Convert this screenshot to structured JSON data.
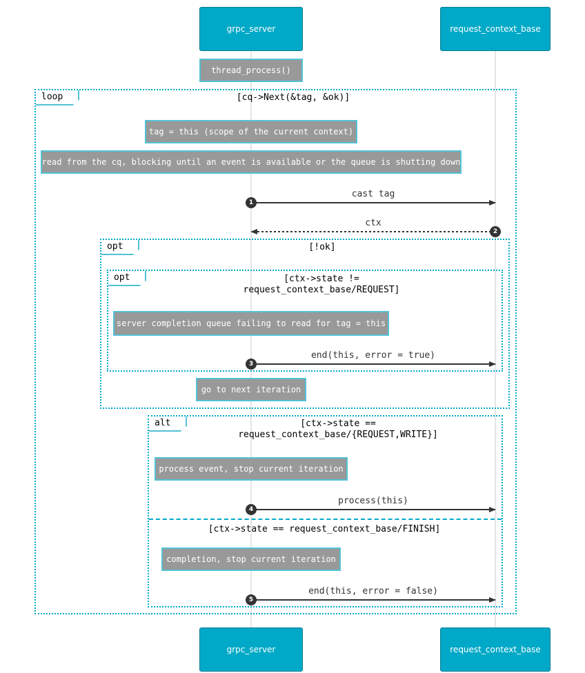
{
  "participants": {
    "grpc_server": "grpc_server",
    "request_context_base": "request_context_base"
  },
  "notes": {
    "thread_process": "thread_process()",
    "tag_this": "tag = this (scope of the current context)",
    "read_cq": "read from the cq, blocking until an event is available or the queue is shutting down",
    "server_fail": "server completion queue failing to read for tag = this",
    "next_iteration": "go to next iteration",
    "process_event": "process event, stop current iteration",
    "completion": "completion, stop current iteration"
  },
  "frames": {
    "loop": {
      "label": "loop",
      "condition": "[cq->Next(&tag, &ok)]"
    },
    "opt_ok": {
      "label": "opt",
      "condition": "[!ok]"
    },
    "opt_state": {
      "label": "opt",
      "condition_line1": "[ctx->state !=",
      "condition_line2": "request_context_base/REQUEST]"
    },
    "alt": {
      "label": "alt",
      "condition_line1": "[ctx->state ==",
      "condition_line2": "request_context_base/{REQUEST,WRITE}]",
      "else_condition": "[ctx->state == request_context_base/FINISH]"
    }
  },
  "messages": [
    {
      "number": "1",
      "label": "cast tag",
      "from": "grpc_server",
      "to": "request_context_base",
      "style": "solid"
    },
    {
      "number": "2",
      "label": "ctx",
      "from": "request_context_base",
      "to": "grpc_server",
      "style": "dashed"
    },
    {
      "number": "3",
      "label": "end(this, error = true)",
      "from": "grpc_server",
      "to": "request_context_base",
      "style": "solid"
    },
    {
      "number": "4",
      "label": "process(this)",
      "from": "grpc_server",
      "to": "request_context_base",
      "style": "solid"
    },
    {
      "number": "5",
      "label": "end(this, error = false)",
      "from": "grpc_server",
      "to": "request_context_base",
      "style": "solid"
    }
  ],
  "colors": {
    "participant_fill": "#00a9c7",
    "frame_border": "#00a9c7",
    "note_fill": "#999999",
    "note_border": "#52c2d6",
    "arrow": "#333333"
  }
}
